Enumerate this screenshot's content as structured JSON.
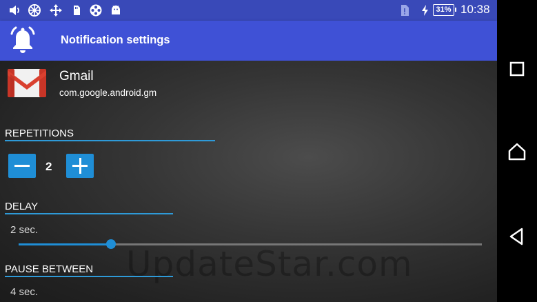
{
  "status_bar": {
    "battery": "31%",
    "time": "10:38",
    "icons": [
      "volume-icon",
      "pinwheel-icon",
      "move-arrows-icon",
      "sd-card-icon",
      "film-reel-icon",
      "android-icon",
      "sim-card-icon",
      "charging-bolt-icon"
    ]
  },
  "toolbar": {
    "title": "Notification settings",
    "icon": "bell-icon"
  },
  "app": {
    "name": "Gmail",
    "package": "com.google.android.gm",
    "icon": "gmail-icon"
  },
  "repetitions": {
    "label": "REPETITIONS",
    "value": "2"
  },
  "delay": {
    "label": "DELAY",
    "value_text": "2 sec.",
    "slider_fraction": 0.2
  },
  "pause_between": {
    "label": "PAUSE BETWEEN",
    "value_text": "4 sec."
  },
  "watermark": "UpdateStar.com",
  "colors": {
    "accent": "#1f8ed6",
    "toolbar": "#3f51d6",
    "status_bar": "#3949b8"
  },
  "nav": {
    "icons": [
      "recents-icon",
      "home-icon",
      "back-icon"
    ]
  }
}
